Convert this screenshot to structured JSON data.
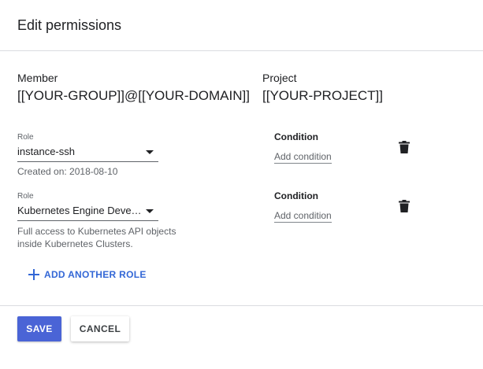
{
  "dialog": {
    "title": "Edit permissions"
  },
  "member": {
    "label": "Member",
    "value": "[[YOUR-GROUP]]@[[YOUR-DOMAIN]]"
  },
  "project": {
    "label": "Project",
    "value": "[[YOUR-PROJECT]]"
  },
  "roles": [
    {
      "field_label": "Role",
      "value": "instance-ssh",
      "helper_lines": [
        "Created on: 2018-08-10"
      ],
      "condition_label": "Condition",
      "condition_link": "Add condition",
      "delete_icon": "trash-icon"
    },
    {
      "field_label": "Role",
      "value": "Kubernetes Engine Devel...",
      "helper_lines": [
        "Full access to Kubernetes API objects",
        "inside Kubernetes Clusters."
      ],
      "condition_label": "Condition",
      "condition_link": "Add condition",
      "delete_icon": "trash-icon"
    }
  ],
  "add_role": {
    "icon": "plus-icon",
    "label": "ADD ANOTHER ROLE"
  },
  "actions": {
    "save_label": "SAVE",
    "cancel_label": "CANCEL"
  },
  "colors": {
    "primary": "#4a64d6",
    "link_blue": "#3367d6",
    "divider": "#dadce0"
  }
}
